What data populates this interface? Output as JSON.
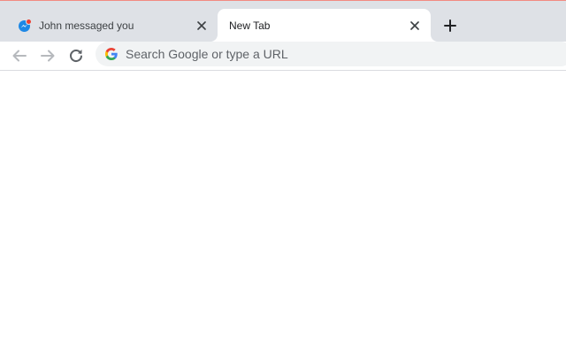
{
  "tabs": [
    {
      "title": "John messaged you",
      "icon": "messenger-icon",
      "active": false
    },
    {
      "title": "New Tab",
      "icon": "",
      "active": true
    }
  ],
  "omnibox": {
    "placeholder": "Search Google or type a URL",
    "value": "",
    "icon": "google-g-icon"
  },
  "toolbar": {
    "back_icon": "back-arrow-icon",
    "forward_icon": "forward-arrow-icon",
    "reload_icon": "reload-icon"
  },
  "colors": {
    "tabstrip": "#dee1e6",
    "active_tab": "#ffffff",
    "omnibox": "#f1f3f4",
    "accent": "#f28b82",
    "messenger_blue": "#1e88e5",
    "notification_red": "#ea4335"
  }
}
